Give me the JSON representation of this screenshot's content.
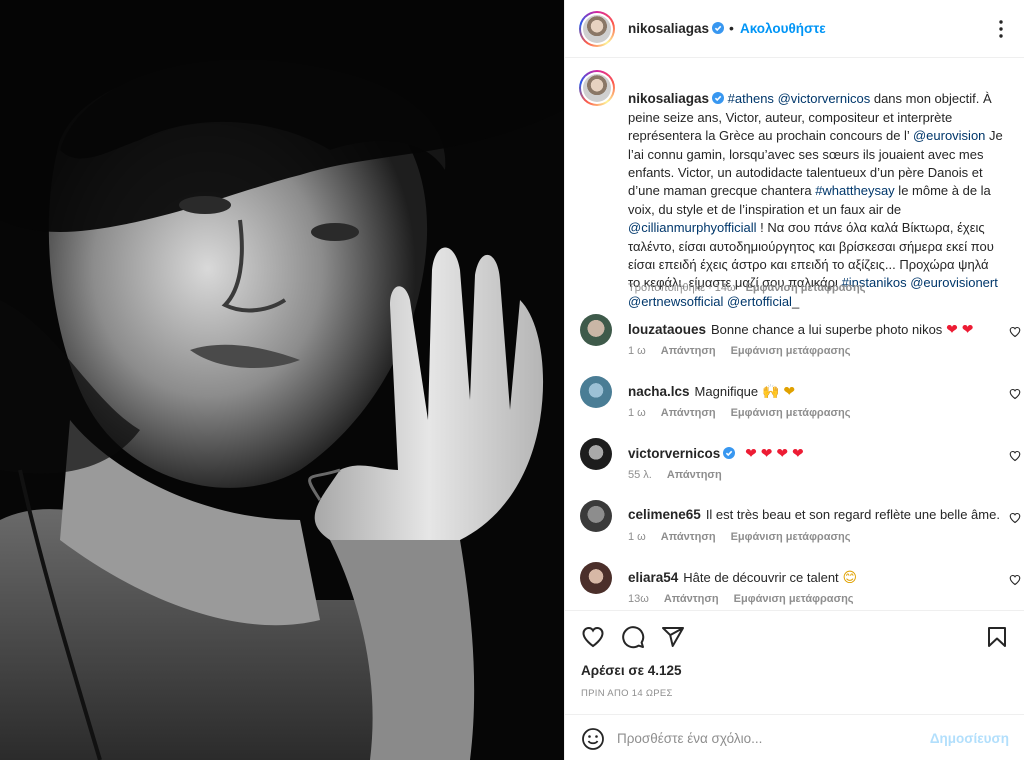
{
  "colors": {
    "follow": "#0095f6",
    "mention": "#00376b",
    "muted": "#8e8e8e",
    "heart": "#ed1c34",
    "post_disabled": "#b2dffc"
  },
  "photo": {
    "alt_icon": "portrait-photo"
  },
  "header": {
    "username": "nikosaliagas",
    "separator": "•",
    "follow_label": "Ακολουθήστε",
    "more_icon": "more-options-icon"
  },
  "caption": {
    "username": "nikosaliagas",
    "segments": [
      {
        "type": "link",
        "text": "#athens"
      },
      {
        "type": "text",
        "text": " "
      },
      {
        "type": "link",
        "text": "@victorvernicos"
      },
      {
        "type": "text",
        "text": " dans mon objectif. À peine seize ans, Victor, auteur, compositeur et interprète représentera la Grèce au prochain concours de l’ "
      },
      {
        "type": "link",
        "text": "@eurovision"
      },
      {
        "type": "text",
        "text": " Je l’ai connu gamin, lorsqu’avec ses sœurs ils jouaient avec mes enfants. Victor, un autodidacte talentueux d’un père Danois et d’une maman grecque chantera "
      },
      {
        "type": "link",
        "text": "#whattheysay"
      },
      {
        "type": "text",
        "text": " le môme à de la voix, du style et de l’inspiration et un faux air de "
      },
      {
        "type": "link",
        "text": "@cillianmurphyofficiall"
      },
      {
        "type": "text",
        "text": " ! Να σου πάνε όλα καλά Βίκτωρα, έχεις ταλέντο, είσαι αυτοδημιούργητος και βρίσκεσαι σήμερα εκεί που είσαι επειδή έχεις άστρο και επειδή το αξίζεις... Προχώρα ψηλά το κεφάλι, είμαστε μαζί σου παλικάρι "
      },
      {
        "type": "link",
        "text": "#instanikos"
      },
      {
        "type": "text",
        "text": " "
      },
      {
        "type": "link",
        "text": "@eurovisionert"
      },
      {
        "type": "text",
        "text": " "
      },
      {
        "type": "link",
        "text": "@ertnewsofficial"
      },
      {
        "type": "text",
        "text": " "
      },
      {
        "type": "link",
        "text": "@ertofficial"
      },
      {
        "type": "text",
        "text": "_"
      }
    ],
    "edited_label": "Τροποποιήθηκε",
    "sep": "·",
    "age": "14ω",
    "translate_label": "Εμφάνιση μετάφρασης"
  },
  "comments": [
    {
      "username": "louzataoues",
      "verified": false,
      "text": "Bonne chance a lui superbe photo nikos",
      "emoji": "❤ ❤",
      "age": "1 ω",
      "reply_label": "Απάντηση",
      "translate_label": "Εμφάνιση μετάφρασης"
    },
    {
      "username": "nacha.lcs",
      "verified": false,
      "text": "Magnifique",
      "emoji": "🙌 ❤",
      "age": "1 ω",
      "reply_label": "Απάντηση",
      "translate_label": "Εμφάνιση μετάφρασης"
    },
    {
      "username": "victorvernicos",
      "verified": true,
      "text": "",
      "emoji": "❤ ❤ ❤ ❤",
      "age": "55 λ.",
      "reply_label": "Απάντηση",
      "translate_label": ""
    },
    {
      "username": "celimene65",
      "verified": false,
      "text": "Il est très beau et son regard reflète une belle âme.",
      "emoji": "",
      "age": "1 ω",
      "reply_label": "Απάντηση",
      "translate_label": "Εμφάνιση μετάφρασης"
    },
    {
      "username": "eliara54",
      "verified": false,
      "text": "Hâte de découvrir ce talent",
      "emoji": "😊",
      "age": "13ω",
      "reply_label": "Απάντηση",
      "translate_label": "Εμφάνιση μετάφρασης"
    }
  ],
  "actions": {
    "like_icon": "heart-icon",
    "comment_icon": "comment-icon",
    "share_icon": "share-icon",
    "save_icon": "bookmark-icon",
    "likes_text": "Αρέσει σε 4.125",
    "time_ago": "ΠΡΙΝ ΑΠΟ 14 ΩΡΕΣ"
  },
  "add_comment": {
    "emoji_icon": "emoji-icon",
    "placeholder": "Προσθέστε ένα σχόλιο...",
    "post_label": "Δημοσίευση"
  }
}
